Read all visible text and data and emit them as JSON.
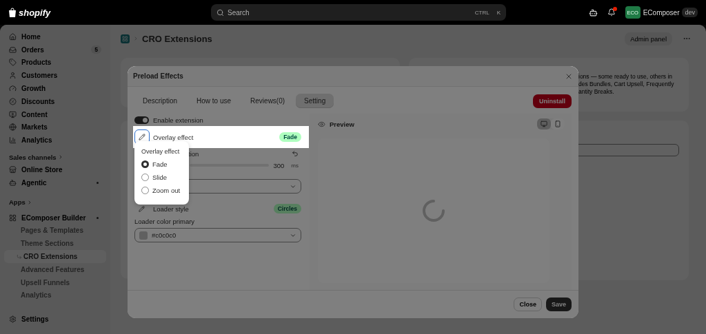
{
  "top_bar": {
    "logo": "shopify",
    "search": {
      "placeholder": "Search",
      "keys": [
        "CTRL",
        "K"
      ]
    },
    "store": {
      "initials": "ECO",
      "name": "EComposer",
      "badge": "dev"
    }
  },
  "sidebar": {
    "items": [
      {
        "label": "Home"
      },
      {
        "label": "Orders",
        "count": "5"
      },
      {
        "label": "Products"
      },
      {
        "label": "Customers"
      },
      {
        "label": "Growth"
      },
      {
        "label": "Discounts"
      },
      {
        "label": "Content"
      },
      {
        "label": "Markets"
      },
      {
        "label": "Analytics"
      }
    ],
    "sales_channels": {
      "heading": "Sales channels",
      "items": [
        {
          "label": "Online Store",
          "dot": false
        },
        {
          "label": "Agentic",
          "dot": true
        }
      ]
    },
    "apps": {
      "heading": "Apps",
      "app": {
        "label": "EComposer Builder",
        "dot": true,
        "children": [
          {
            "label": "Pages & Templates",
            "selected": false
          },
          {
            "label": "Theme Sections",
            "selected": false
          },
          {
            "label": "CRO Extensions",
            "selected": true
          },
          {
            "label": "Advanced Features",
            "selected": false
          },
          {
            "label": "Upsell Funnels",
            "selected": false
          },
          {
            "label": "Analytics",
            "selected": false
          }
        ]
      }
    },
    "settings": "Settings"
  },
  "page": {
    "title": "CRO Extensions",
    "admin_button": "Admin panel",
    "intro_lines": [
      "ions — some ready to use, others in",
      "des Bundles, Cart Upsell, Frequently",
      "antity Breaks."
    ]
  },
  "modal": {
    "title": "Preload Effects",
    "tabs": [
      {
        "label": "Description",
        "selected": false
      },
      {
        "label": "How to use",
        "selected": false
      },
      {
        "label": "Reviews(0)",
        "selected": false
      },
      {
        "label": "Setting",
        "selected": true
      }
    ],
    "uninstall": "Uninstall",
    "enable": {
      "label": "Enable extension",
      "on": true
    },
    "overlay": {
      "label": "Overlay effect",
      "badge": "Fade"
    },
    "popover": {
      "title": "Overlay effect",
      "options": [
        {
          "label": "Fade",
          "selected": true
        },
        {
          "label": "Slide",
          "selected": false
        },
        {
          "label": "Zoom out",
          "selected": false
        }
      ]
    },
    "duration": {
      "label": "tion",
      "value": "300",
      "unit": "ms"
    },
    "loader_style": {
      "label": "Loader style",
      "badge": "Circles"
    },
    "color": {
      "label": "Loader color primary",
      "value": "#c0c0c0"
    },
    "preview": {
      "label": "Preview",
      "devices": [
        {
          "selected": true
        },
        {
          "selected": false
        }
      ]
    },
    "footer": {
      "close": "Close",
      "save": "Save"
    }
  }
}
